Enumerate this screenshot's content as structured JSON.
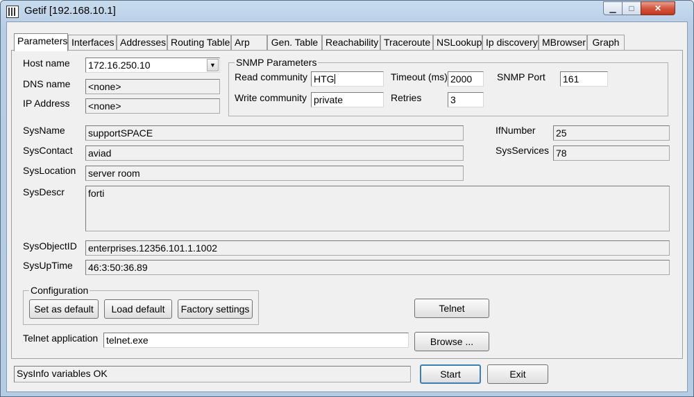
{
  "window": {
    "title": "Getif [192.168.10.1]",
    "min_glyph": "▁",
    "max_glyph": "□",
    "close_glyph": "✕"
  },
  "tabs": [
    "Parameters",
    "Interfaces",
    "Addresses",
    "Routing Table",
    "Arp",
    "Gen. Table",
    "Reachability",
    "Traceroute",
    "NSLookup",
    "Ip discovery",
    "MBrowser",
    "Graph"
  ],
  "host": {
    "host_name_label": "Host name",
    "host_name_value": "172.16.250.10",
    "dns_name_label": "DNS name",
    "dns_name_value": "<none>",
    "ip_label": "IP Address",
    "ip_value": "<none>",
    "dropdown_glyph": "▼"
  },
  "snmp": {
    "title": "SNMP Parameters",
    "read_label": "Read community",
    "read_value": "HTG",
    "write_label": "Write community",
    "write_value": "private",
    "timeout_label": "Timeout (ms)",
    "timeout_value": "2000",
    "retries_label": "Retries",
    "retries_value": "3",
    "port_label": "SNMP Port",
    "port_value": "161"
  },
  "sysinfo": {
    "sysname_label": "SysName",
    "sysname_value": "supportSPACE",
    "syscontact_label": "SysContact",
    "syscontact_value": "aviad",
    "syslocation_label": "SysLocation",
    "syslocation_value": "server room",
    "sysdescr_label": "SysDescr",
    "sysdescr_value": "forti",
    "sysobjectid_label": "SysObjectID",
    "sysobjectid_value": "enterprises.12356.101.1.1002",
    "sysuptime_label": "SysUpTime",
    "sysuptime_value": "46:3:50:36.89",
    "ifnumber_label": "IfNumber",
    "ifnumber_value": "25",
    "sysservices_label": "SysServices",
    "sysservices_value": "78"
  },
  "configuration": {
    "title": "Configuration",
    "set_default": "Set as default",
    "load_default": "Load default",
    "factory": "Factory settings"
  },
  "telnet": {
    "button": "Telnet",
    "app_label": "Telnet application",
    "app_value": "telnet.exe",
    "browse": "Browse ..."
  },
  "status": {
    "text": "SysInfo variables OK",
    "start": "Start",
    "exit": "Exit"
  }
}
